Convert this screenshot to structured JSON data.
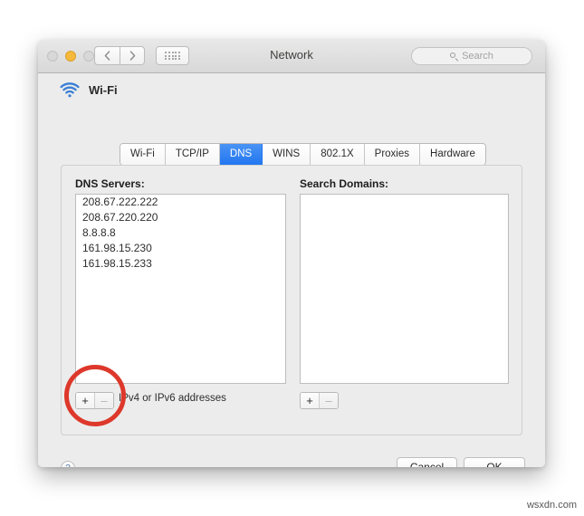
{
  "window": {
    "title": "Network",
    "traffic_lights": [
      {
        "name": "close",
        "active": false
      },
      {
        "name": "minimize",
        "active": true
      },
      {
        "name": "zoom",
        "active": false
      }
    ],
    "nav_back_icon": "chevron-left-icon",
    "nav_forward_icon": "chevron-right-icon",
    "grid_icon": "show-all-grid-icon"
  },
  "search": {
    "placeholder": "Search",
    "icon": "search-icon",
    "value": ""
  },
  "service": {
    "name": "Wi-Fi",
    "icon": "wifi-icon"
  },
  "tabs": [
    {
      "label": "Wi-Fi",
      "selected": false
    },
    {
      "label": "TCP/IP",
      "selected": false
    },
    {
      "label": "DNS",
      "selected": true
    },
    {
      "label": "WINS",
      "selected": false
    },
    {
      "label": "802.1X",
      "selected": false
    },
    {
      "label": "Proxies",
      "selected": false
    },
    {
      "label": "Hardware",
      "selected": false
    }
  ],
  "dns": {
    "label": "DNS Servers:",
    "servers": [
      "208.67.222.222",
      "208.67.220.220",
      "8.8.8.8",
      "161.98.15.230",
      "161.98.15.233"
    ],
    "add_label": "+",
    "remove_label": "–",
    "hint": "IPv4 or IPv6 addresses"
  },
  "search_domains": {
    "label": "Search Domains:",
    "domains": [],
    "add_label": "+",
    "remove_label": "–"
  },
  "footer": {
    "help_label": "?",
    "cancel_label": "Cancel",
    "ok_label": "OK"
  },
  "annotation": {
    "shape": "circle-highlight",
    "color": "#dd382b",
    "target": "dns-add-remove-stepper"
  },
  "watermark": {
    "text": "wsxdn.com"
  },
  "colors": {
    "accent_blue": "#2277ef",
    "annotation_red": "#dd382b",
    "window_bg": "#ececec",
    "wifi_icon": "#3a7fd5"
  }
}
